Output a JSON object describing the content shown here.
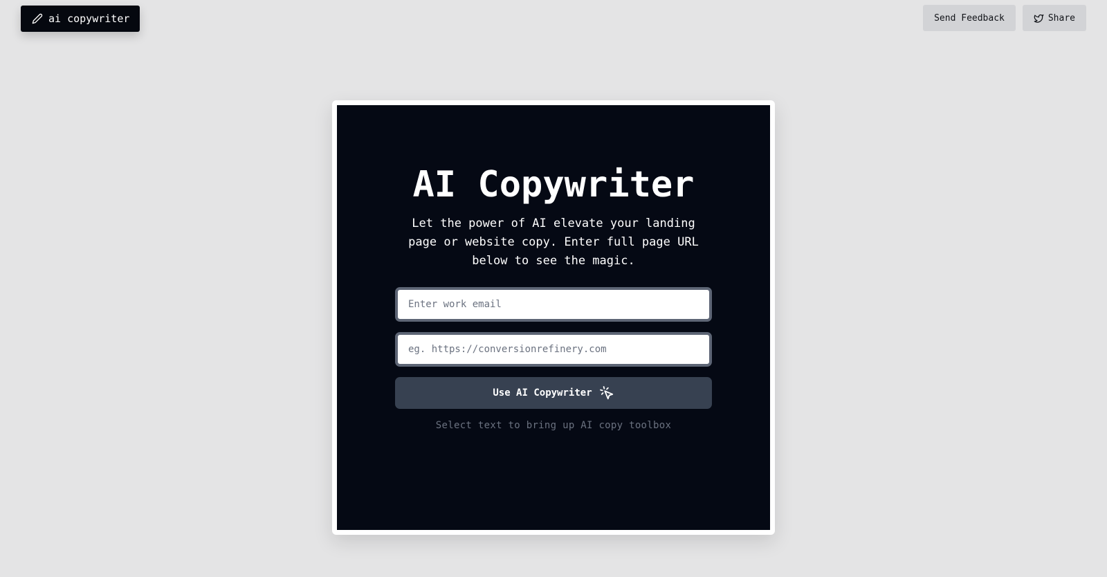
{
  "brand": {
    "label": "ai copywriter",
    "icon": "pencil-icon"
  },
  "top_actions": {
    "feedback_label": "Send Feedback",
    "share_label": "Share",
    "share_icon": "twitter-bird-icon"
  },
  "hero": {
    "title": "AI Copywriter",
    "subtitle": "Let the power of AI elevate your landing page or website copy. Enter full page URL below to see the magic."
  },
  "form": {
    "email": {
      "value": "",
      "placeholder": "Enter work email"
    },
    "url": {
      "value": "",
      "placeholder": "eg. https://conversionrefinery.com"
    },
    "submit_label": "Use AI Copywriter",
    "submit_icon": "cursor-click-icon",
    "hint": "Select text to bring up AI copy toolbox"
  },
  "colors": {
    "page_bg": "#e4e4e5",
    "card_bg": "#050914",
    "button_bg": "#374151",
    "input_border": "#5d6575",
    "hint_text": "#6b7280"
  }
}
